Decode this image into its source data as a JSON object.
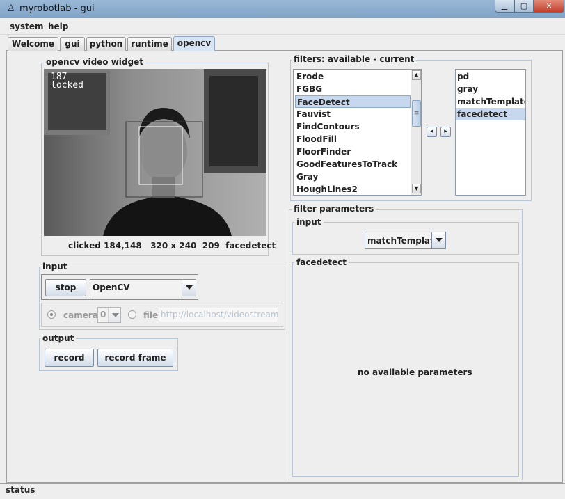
{
  "window": {
    "title": "myrobotlab - gui"
  },
  "menu": [
    "system",
    "help"
  ],
  "tabs": [
    "Welcome",
    "gui",
    "python",
    "runtime",
    "opencv"
  ],
  "video_widget": {
    "title": "opencv  video widget",
    "overlay_count": "187",
    "overlay_state": "locked",
    "status": "clicked 184,148   320 x 240  209  facedetect"
  },
  "input_panel": {
    "title": "input",
    "stop_label": "stop",
    "source_selected": "OpenCV",
    "camera_label": "camera",
    "camera_index": "0",
    "file_label": "file",
    "file_url": "http://localhost/videostream.cgi"
  },
  "output_panel": {
    "title": "output",
    "record_label": "record",
    "record_frame_label": "record frame"
  },
  "filters": {
    "title": "filters: available - current",
    "available": [
      "Erode",
      "FGBG",
      "FaceDetect",
      "Fauvist",
      "FindContours",
      "FloodFill",
      "FloorFinder",
      "GoodFeaturesToTrack",
      "Gray",
      "HoughLines2"
    ],
    "available_selected": "FaceDetect",
    "current": [
      "pd",
      "gray",
      "matchTemplate",
      "facedetect"
    ],
    "current_selected": "facedetect"
  },
  "filter_parameters": {
    "title": "filter parameters",
    "input_title": "input",
    "input_selected": "matchTemplate",
    "facedetect_title": "facedetect",
    "empty_message": "no available parameters"
  },
  "statusbar": {
    "text": "status"
  }
}
